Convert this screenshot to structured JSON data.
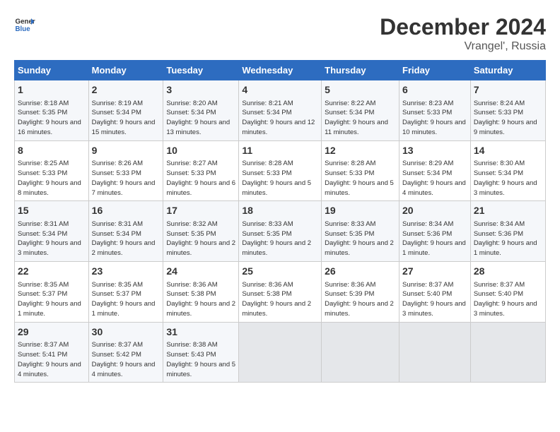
{
  "header": {
    "logo_line1": "General",
    "logo_line2": "Blue",
    "month": "December 2024",
    "location": "Vrangel', Russia"
  },
  "weekdays": [
    "Sunday",
    "Monday",
    "Tuesday",
    "Wednesday",
    "Thursday",
    "Friday",
    "Saturday"
  ],
  "weeks": [
    [
      {
        "day": "1",
        "sunrise": "Sunrise: 8:18 AM",
        "sunset": "Sunset: 5:35 PM",
        "daylight": "Daylight: 9 hours and 16 minutes."
      },
      {
        "day": "2",
        "sunrise": "Sunrise: 8:19 AM",
        "sunset": "Sunset: 5:34 PM",
        "daylight": "Daylight: 9 hours and 15 minutes."
      },
      {
        "day": "3",
        "sunrise": "Sunrise: 8:20 AM",
        "sunset": "Sunset: 5:34 PM",
        "daylight": "Daylight: 9 hours and 13 minutes."
      },
      {
        "day": "4",
        "sunrise": "Sunrise: 8:21 AM",
        "sunset": "Sunset: 5:34 PM",
        "daylight": "Daylight: 9 hours and 12 minutes."
      },
      {
        "day": "5",
        "sunrise": "Sunrise: 8:22 AM",
        "sunset": "Sunset: 5:34 PM",
        "daylight": "Daylight: 9 hours and 11 minutes."
      },
      {
        "day": "6",
        "sunrise": "Sunrise: 8:23 AM",
        "sunset": "Sunset: 5:33 PM",
        "daylight": "Daylight: 9 hours and 10 minutes."
      },
      {
        "day": "7",
        "sunrise": "Sunrise: 8:24 AM",
        "sunset": "Sunset: 5:33 PM",
        "daylight": "Daylight: 9 hours and 9 minutes."
      }
    ],
    [
      {
        "day": "8",
        "sunrise": "Sunrise: 8:25 AM",
        "sunset": "Sunset: 5:33 PM",
        "daylight": "Daylight: 9 hours and 8 minutes."
      },
      {
        "day": "9",
        "sunrise": "Sunrise: 8:26 AM",
        "sunset": "Sunset: 5:33 PM",
        "daylight": "Daylight: 9 hours and 7 minutes."
      },
      {
        "day": "10",
        "sunrise": "Sunrise: 8:27 AM",
        "sunset": "Sunset: 5:33 PM",
        "daylight": "Daylight: 9 hours and 6 minutes."
      },
      {
        "day": "11",
        "sunrise": "Sunrise: 8:28 AM",
        "sunset": "Sunset: 5:33 PM",
        "daylight": "Daylight: 9 hours and 5 minutes."
      },
      {
        "day": "12",
        "sunrise": "Sunrise: 8:28 AM",
        "sunset": "Sunset: 5:33 PM",
        "daylight": "Daylight: 9 hours and 5 minutes."
      },
      {
        "day": "13",
        "sunrise": "Sunrise: 8:29 AM",
        "sunset": "Sunset: 5:34 PM",
        "daylight": "Daylight: 9 hours and 4 minutes."
      },
      {
        "day": "14",
        "sunrise": "Sunrise: 8:30 AM",
        "sunset": "Sunset: 5:34 PM",
        "daylight": "Daylight: 9 hours and 3 minutes."
      }
    ],
    [
      {
        "day": "15",
        "sunrise": "Sunrise: 8:31 AM",
        "sunset": "Sunset: 5:34 PM",
        "daylight": "Daylight: 9 hours and 3 minutes."
      },
      {
        "day": "16",
        "sunrise": "Sunrise: 8:31 AM",
        "sunset": "Sunset: 5:34 PM",
        "daylight": "Daylight: 9 hours and 2 minutes."
      },
      {
        "day": "17",
        "sunrise": "Sunrise: 8:32 AM",
        "sunset": "Sunset: 5:35 PM",
        "daylight": "Daylight: 9 hours and 2 minutes."
      },
      {
        "day": "18",
        "sunrise": "Sunrise: 8:33 AM",
        "sunset": "Sunset: 5:35 PM",
        "daylight": "Daylight: 9 hours and 2 minutes."
      },
      {
        "day": "19",
        "sunrise": "Sunrise: 8:33 AM",
        "sunset": "Sunset: 5:35 PM",
        "daylight": "Daylight: 9 hours and 2 minutes."
      },
      {
        "day": "20",
        "sunrise": "Sunrise: 8:34 AM",
        "sunset": "Sunset: 5:36 PM",
        "daylight": "Daylight: 9 hours and 1 minute."
      },
      {
        "day": "21",
        "sunrise": "Sunrise: 8:34 AM",
        "sunset": "Sunset: 5:36 PM",
        "daylight": "Daylight: 9 hours and 1 minute."
      }
    ],
    [
      {
        "day": "22",
        "sunrise": "Sunrise: 8:35 AM",
        "sunset": "Sunset: 5:37 PM",
        "daylight": "Daylight: 9 hours and 1 minute."
      },
      {
        "day": "23",
        "sunrise": "Sunrise: 8:35 AM",
        "sunset": "Sunset: 5:37 PM",
        "daylight": "Daylight: 9 hours and 1 minute."
      },
      {
        "day": "24",
        "sunrise": "Sunrise: 8:36 AM",
        "sunset": "Sunset: 5:38 PM",
        "daylight": "Daylight: 9 hours and 2 minutes."
      },
      {
        "day": "25",
        "sunrise": "Sunrise: 8:36 AM",
        "sunset": "Sunset: 5:38 PM",
        "daylight": "Daylight: 9 hours and 2 minutes."
      },
      {
        "day": "26",
        "sunrise": "Sunrise: 8:36 AM",
        "sunset": "Sunset: 5:39 PM",
        "daylight": "Daylight: 9 hours and 2 minutes."
      },
      {
        "day": "27",
        "sunrise": "Sunrise: 8:37 AM",
        "sunset": "Sunset: 5:40 PM",
        "daylight": "Daylight: 9 hours and 3 minutes."
      },
      {
        "day": "28",
        "sunrise": "Sunrise: 8:37 AM",
        "sunset": "Sunset: 5:40 PM",
        "daylight": "Daylight: 9 hours and 3 minutes."
      }
    ],
    [
      {
        "day": "29",
        "sunrise": "Sunrise: 8:37 AM",
        "sunset": "Sunset: 5:41 PM",
        "daylight": "Daylight: 9 hours and 4 minutes."
      },
      {
        "day": "30",
        "sunrise": "Sunrise: 8:37 AM",
        "sunset": "Sunset: 5:42 PM",
        "daylight": "Daylight: 9 hours and 4 minutes."
      },
      {
        "day": "31",
        "sunrise": "Sunrise: 8:38 AM",
        "sunset": "Sunset: 5:43 PM",
        "daylight": "Daylight: 9 hours and 5 minutes."
      },
      null,
      null,
      null,
      null
    ]
  ]
}
